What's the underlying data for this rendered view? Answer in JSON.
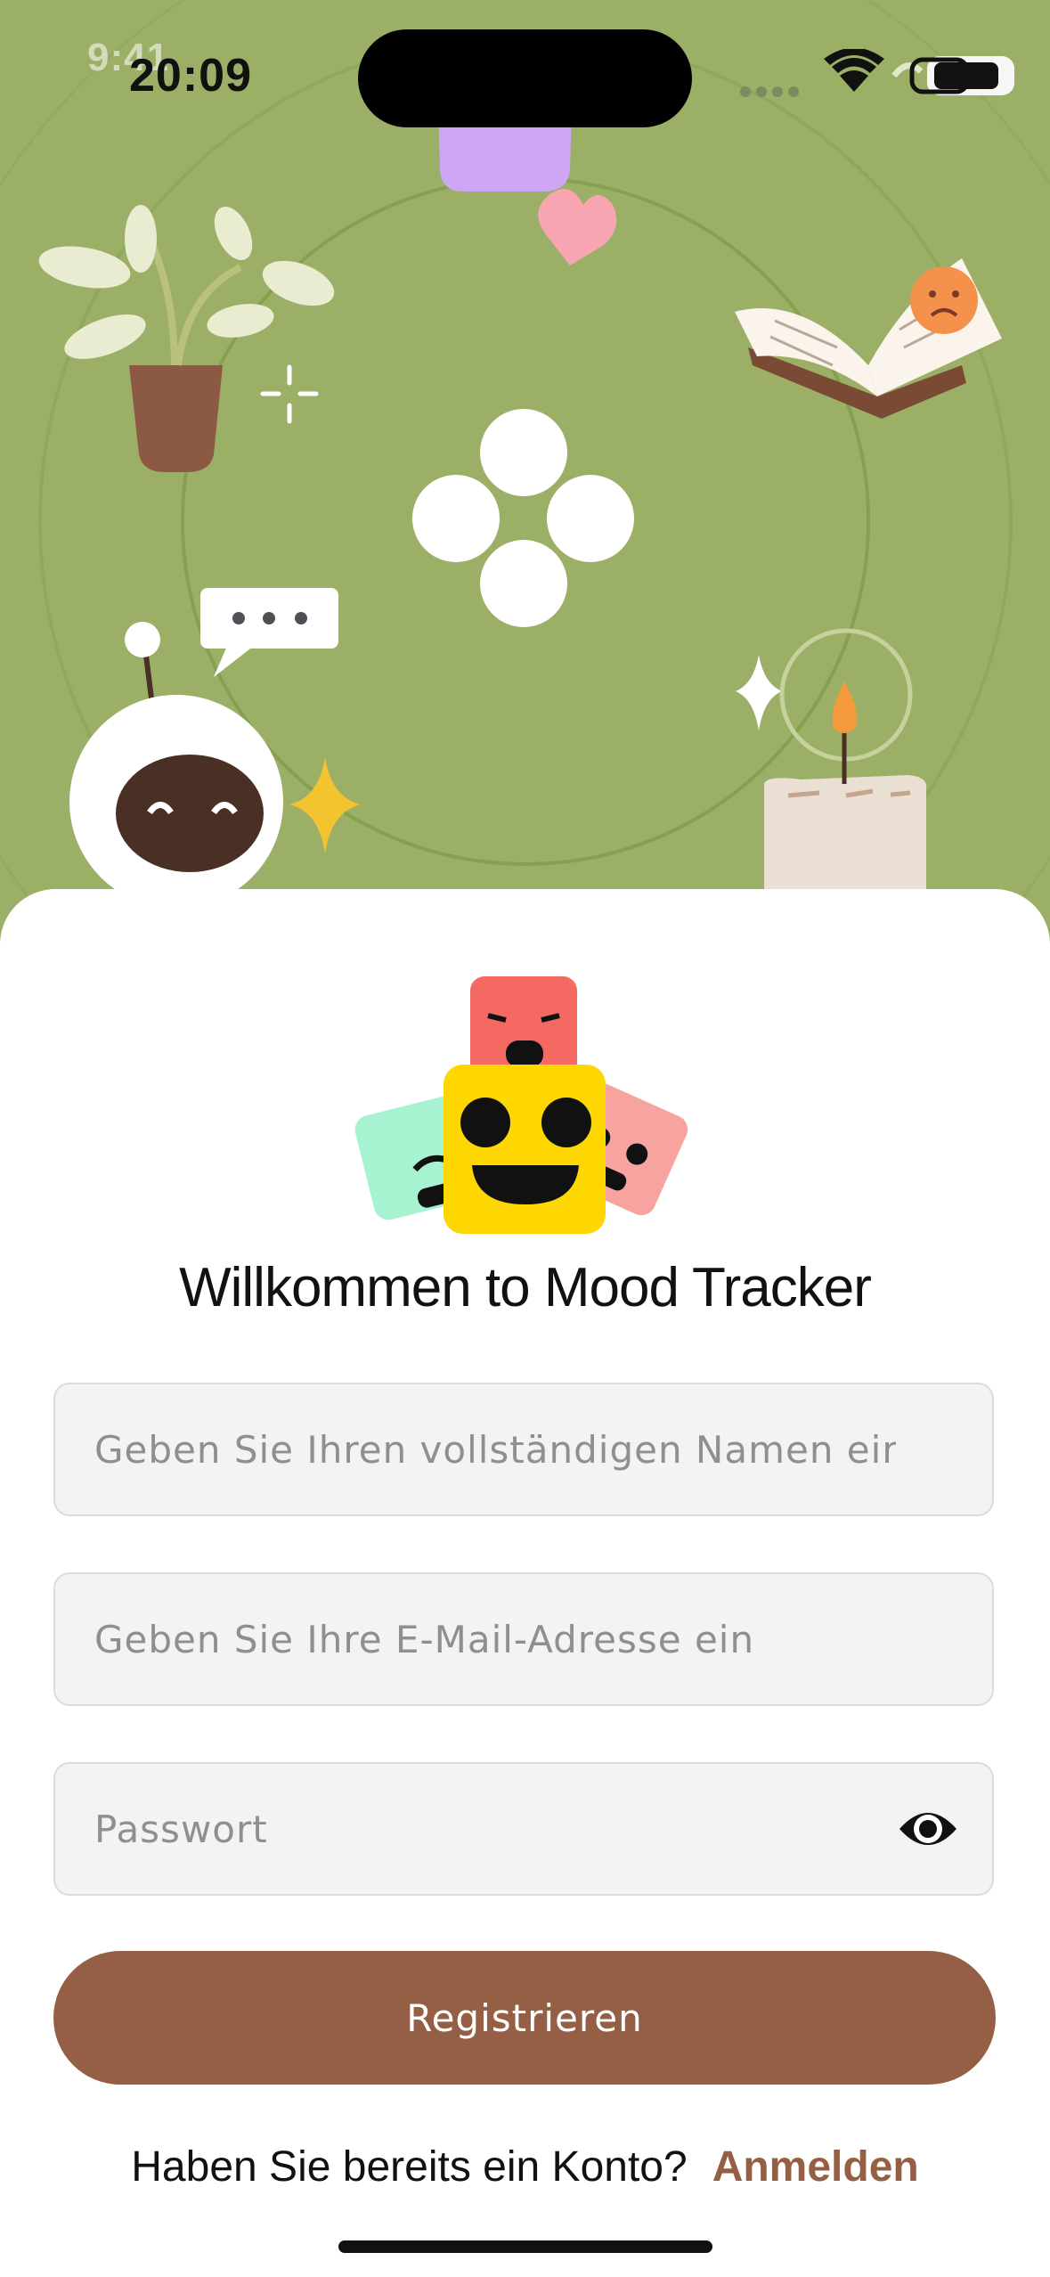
{
  "status_bar": {
    "time": "20:09",
    "time_ghost": "9:41",
    "icons": [
      "signal-dots-icon",
      "wifi-icon",
      "battery-icon"
    ]
  },
  "hero": {
    "illustrations": [
      "plant-icon",
      "heart-icon",
      "book-icon",
      "sad-face-icon",
      "flower-icon",
      "robot-icon",
      "speech-bubble-icon",
      "sparkle-icon",
      "candle-icon"
    ]
  },
  "welcome": {
    "title": "Willkommen to Mood Tracker"
  },
  "form": {
    "name_placeholder": "Geben Sie Ihren vollständigen Namen ein",
    "email_placeholder": "Geben Sie Ihre E-Mail-Adresse ein",
    "password_placeholder": "Passwort",
    "password_toggle_icon": "eye-icon",
    "register_label": "Registrieren"
  },
  "footer": {
    "question": "Haben Sie bereits ein Konto?",
    "login_link": "Anmelden"
  },
  "colors": {
    "hero_background": "#9bb066",
    "accent_brown": "#945f44",
    "field_background": "#f3f3f4"
  }
}
